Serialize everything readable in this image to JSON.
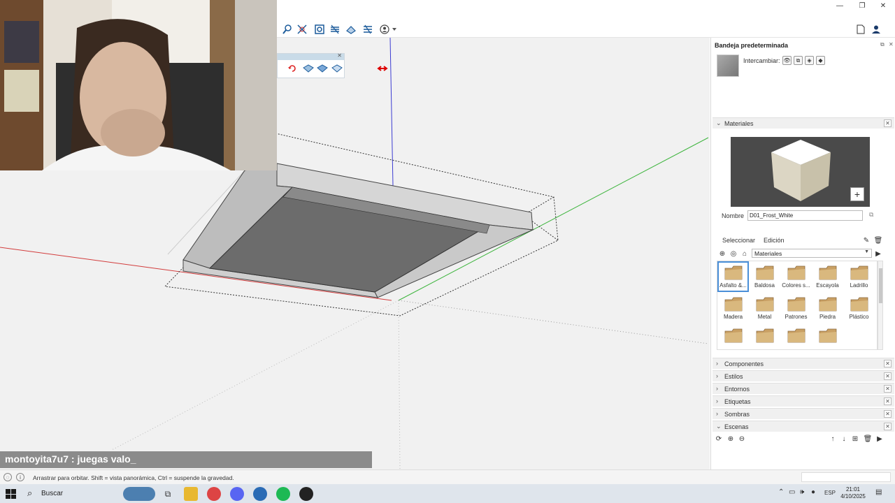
{
  "tray": {
    "title": "Bandeja predeterminada",
    "swap_label": "Intercambiar:"
  },
  "materials": {
    "section_title": "Materiales",
    "name_label": "Nombre",
    "name_value": "D01_Frost_White",
    "tab_select": "Seleccionar",
    "tab_edit": "Edición",
    "library": "Materiales",
    "items": [
      "Asfalto &...",
      "Baldosa",
      "Colores s...",
      "Escayola",
      "Ladrillo",
      "Madera",
      "Metal",
      "Patrones",
      "Piedra",
      "Plástico",
      "",
      "",
      "",
      ""
    ]
  },
  "sections": [
    {
      "label": "Componentes",
      "chevron": "›"
    },
    {
      "label": "Estilos",
      "chevron": "›"
    },
    {
      "label": "Entornos",
      "chevron": "›"
    },
    {
      "label": "Etiquetas",
      "chevron": "›"
    },
    {
      "label": "Sombras",
      "chevron": "›"
    },
    {
      "label": "Escenas",
      "chevron": "⌄"
    }
  ],
  "chat": {
    "text": "montoyita7u7 : juegas valo_"
  },
  "status": {
    "text": "Arrastrar para orbitar. Shift = vista panorámica, Ctrl = suspende la gravedad."
  },
  "taskbar": {
    "search": "Buscar",
    "lang": "ESP",
    "time": "21:01",
    "date": "4/10/2025"
  },
  "colors": {
    "accent": "#4a8fd8",
    "axis_red": "#d23c3c",
    "axis_green": "#3cb43c",
    "axis_blue": "#3c3cd2"
  }
}
